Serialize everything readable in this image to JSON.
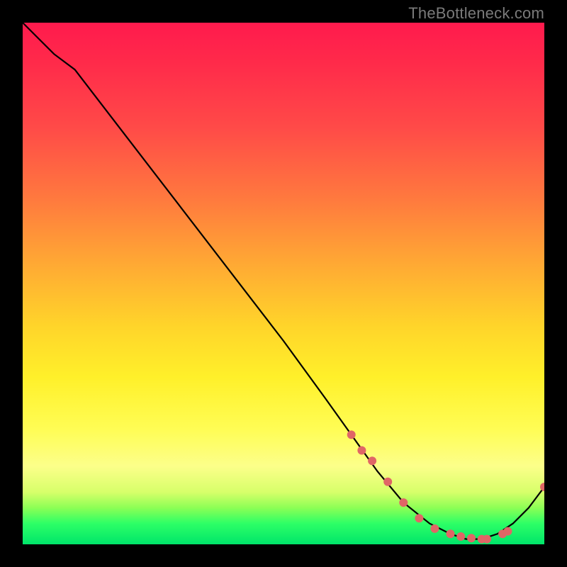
{
  "watermark": "TheBottleneck.com",
  "chart_data": {
    "type": "line",
    "title": "",
    "xlabel": "",
    "ylabel": "",
    "xlim": [
      0,
      100
    ],
    "ylim": [
      0,
      100
    ],
    "grid": false,
    "series": [
      {
        "name": "bottleneck-curve",
        "x": [
          0,
          3,
          6,
          10,
          20,
          30,
          40,
          50,
          58,
          63,
          68,
          73,
          78,
          82,
          85,
          88,
          91,
          94,
          97,
          100
        ],
        "values": [
          100,
          97,
          94,
          91,
          78,
          65,
          52,
          39,
          28,
          21,
          14,
          8,
          4,
          2,
          1,
          1,
          2,
          4,
          7,
          11
        ]
      }
    ],
    "markers": {
      "name": "highlighted-range",
      "color": "#e06666",
      "points_x": [
        63,
        65,
        67,
        70,
        73,
        76,
        79,
        82,
        84,
        86,
        88,
        89,
        92,
        93,
        100
      ],
      "points_y": [
        21,
        18,
        16,
        12,
        8,
        5,
        3,
        2,
        1.5,
        1.2,
        1,
        1,
        2,
        2.5,
        11
      ]
    },
    "background_gradient": {
      "top": "#ff1a4d",
      "mid": "#ffd42a",
      "bottom": "#00e56a"
    }
  }
}
